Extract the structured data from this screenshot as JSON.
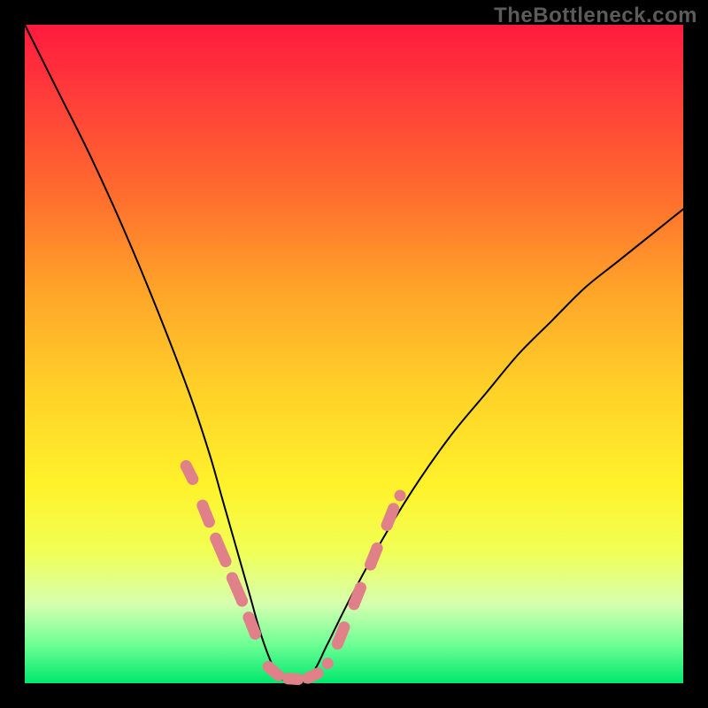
{
  "watermark": "TheBottleneck.com",
  "colors": {
    "curve_stroke": "#000000",
    "dot_fill": "#e08088",
    "background_frame": "#000000"
  },
  "chart_data": {
    "type": "line",
    "title": "",
    "xlabel": "",
    "ylabel": "",
    "xlim": [
      0,
      100
    ],
    "ylim": [
      0,
      100
    ],
    "series": [
      {
        "name": "bottleneck-curve",
        "x": [
          0,
          5,
          10,
          15,
          20,
          25,
          28,
          30,
          32,
          34,
          36,
          38,
          40,
          42,
          44,
          46,
          50,
          55,
          60,
          65,
          70,
          75,
          80,
          85,
          90,
          95,
          100
        ],
        "values": [
          100,
          90,
          80,
          69,
          57,
          44,
          35,
          28,
          21,
          14,
          7,
          2,
          0,
          0,
          2,
          6,
          14,
          23,
          31,
          38,
          44,
          50,
          55,
          60,
          64,
          68,
          72
        ]
      }
    ],
    "dots": {
      "left_cluster": [
        {
          "x": 24.5,
          "y": 33.0
        },
        {
          "x": 25.5,
          "y": 31.0
        },
        {
          "x": 27.0,
          "y": 27.0
        },
        {
          "x": 28.0,
          "y": 24.5
        },
        {
          "x": 29.0,
          "y": 22.0
        },
        {
          "x": 30.5,
          "y": 18.5
        },
        {
          "x": 31.5,
          "y": 16.0
        },
        {
          "x": 33.0,
          "y": 12.5
        },
        {
          "x": 34.0,
          "y": 10.0
        },
        {
          "x": 35.0,
          "y": 7.5
        }
      ],
      "valley_cluster": [
        {
          "x": 37.0,
          "y": 2.5
        },
        {
          "x": 38.5,
          "y": 1.2
        },
        {
          "x": 40.0,
          "y": 0.7
        },
        {
          "x": 41.5,
          "y": 0.6
        },
        {
          "x": 43.0,
          "y": 0.8
        },
        {
          "x": 44.5,
          "y": 1.5
        },
        {
          "x": 46.0,
          "y": 3.0
        }
      ],
      "right_cluster": [
        {
          "x": 47.5,
          "y": 6.0
        },
        {
          "x": 48.5,
          "y": 8.5
        },
        {
          "x": 50.0,
          "y": 12.0
        },
        {
          "x": 51.0,
          "y": 14.5
        },
        {
          "x": 52.5,
          "y": 18.0
        },
        {
          "x": 53.5,
          "y": 20.5
        },
        {
          "x": 55.0,
          "y": 24.0
        },
        {
          "x": 56.0,
          "y": 26.5
        },
        {
          "x": 57.0,
          "y": 28.5
        }
      ]
    }
  }
}
